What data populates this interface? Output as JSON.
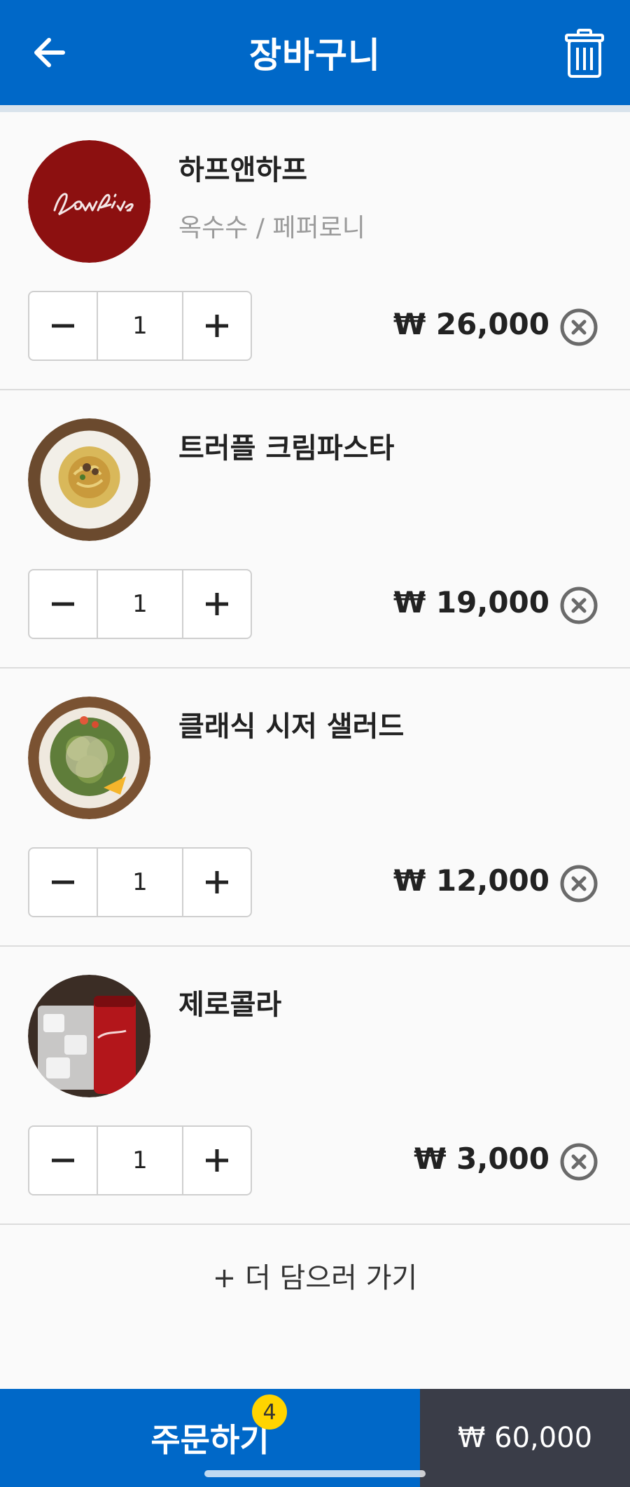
{
  "header": {
    "title": "장바구니",
    "back_icon": "arrow-left-icon",
    "trash_icon": "trash-icon"
  },
  "colors": {
    "primary": "#0068c8",
    "total_bg": "#3a3d48",
    "badge": "#ffd400"
  },
  "items": [
    {
      "name": "하프앤하프",
      "option": "옥수수 / 페퍼로니",
      "quantity": "1",
      "price": "₩ 26,000",
      "image": "lowfive-logo"
    },
    {
      "name": "트러플 크림파스타",
      "option": "",
      "quantity": "1",
      "price": "₩ 19,000",
      "image": "truffle-pasta-photo"
    },
    {
      "name": "클래식 시저 샐러드",
      "option": "",
      "quantity": "1",
      "price": "₩ 12,000",
      "image": "caesar-salad-photo"
    },
    {
      "name": "제로콜라",
      "option": "",
      "quantity": "1",
      "price": "₩ 3,000",
      "image": "zero-cola-photo"
    }
  ],
  "add_more_label": "+ 더 담으러 가기",
  "footer": {
    "order_label": "주문하기",
    "badge_count": "4",
    "total": "₩ 60,000"
  }
}
